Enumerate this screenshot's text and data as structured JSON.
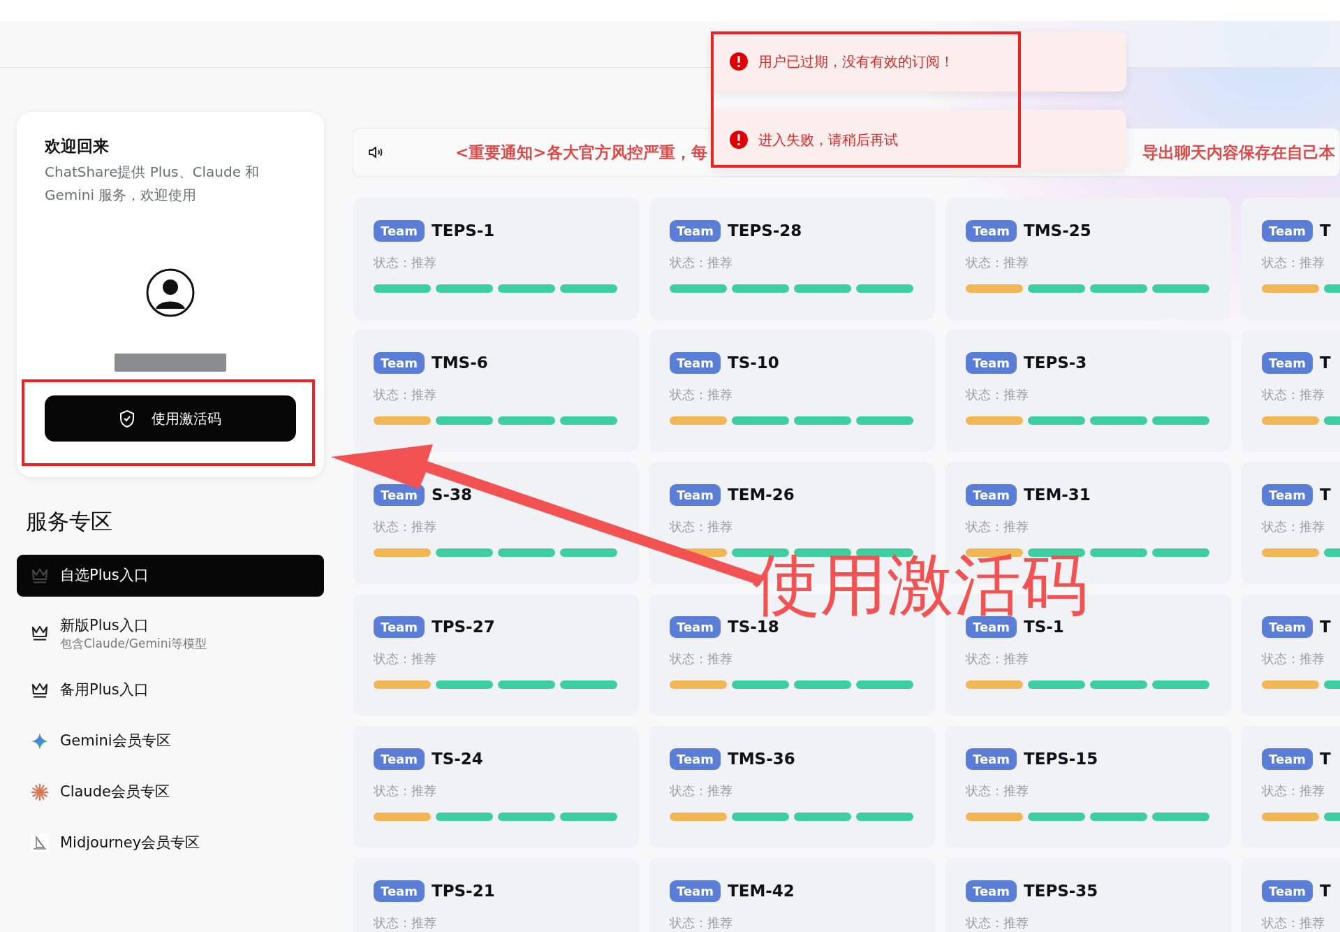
{
  "toasts": [
    {
      "message": "用户已过期，没有有效的订阅！"
    },
    {
      "message": "进入失败，请稍后再试"
    }
  ],
  "welcome": {
    "title": "欢迎回来",
    "subtitle": "ChatShare提供 Plus、Claude 和 Gemini 服务，欢迎使用",
    "activate_button": "使用激活码"
  },
  "services": {
    "heading": "服务专区",
    "items": [
      {
        "kind": "crown",
        "label": "自选Plus入口",
        "selected": true
      },
      {
        "kind": "crown",
        "label": "新版Plus入口",
        "sublabel": "包含Claude/Gemini等模型",
        "selected": false
      },
      {
        "kind": "crown",
        "label": "备用Plus入口",
        "selected": false
      },
      {
        "kind": "gemini",
        "label": "Gemini会员专区",
        "selected": false
      },
      {
        "kind": "claude",
        "label": "Claude会员专区",
        "selected": false
      },
      {
        "kind": "sailboat",
        "label": "Midjourney会员专区",
        "selected": false
      }
    ]
  },
  "notice": {
    "text_left": "<重要通知>各大官方风控严重，每",
    "text_right": "导出聊天内容保存在自己本"
  },
  "cards": [
    {
      "badge": "Team",
      "name": "TEPS-1",
      "status": "状态：推荐",
      "segments": [
        {
          "color": "#3ecfa0"
        },
        {
          "color": "#3ecfa0"
        },
        {
          "color": "#3ecfa0"
        },
        {
          "color": "#3ecfa0"
        }
      ]
    },
    {
      "badge": "Team",
      "name": "TEPS-28",
      "status": "状态：推荐",
      "segments": [
        {
          "color": "#3ecfa0"
        },
        {
          "color": "#3ecfa0"
        },
        {
          "color": "#3ecfa0"
        },
        {
          "color": "#3ecfa0"
        }
      ]
    },
    {
      "badge": "Team",
      "name": "TMS-25",
      "status": "状态：推荐",
      "segments": [
        {
          "color": "#f2b655"
        },
        {
          "color": "#3ecfa0"
        },
        {
          "color": "#3ecfa0"
        },
        {
          "color": "#3ecfa0"
        }
      ]
    },
    {
      "badge": "Team",
      "name": "T",
      "status": "状态：推荐",
      "segments": [
        {
          "color": "#f2b655"
        },
        {
          "color": "#3ecfa0"
        }
      ]
    },
    {
      "badge": "Team",
      "name": "TMS-6",
      "status": "状态：推荐",
      "segments": [
        {
          "color": "#f2b655"
        },
        {
          "color": "#3ecfa0"
        },
        {
          "color": "#3ecfa0"
        },
        {
          "color": "#3ecfa0"
        }
      ]
    },
    {
      "badge": "Team",
      "name": "TS-10",
      "status": "状态：推荐",
      "segments": [
        {
          "color": "#f2b655"
        },
        {
          "color": "#3ecfa0"
        },
        {
          "color": "#3ecfa0"
        },
        {
          "color": "#3ecfa0"
        }
      ]
    },
    {
      "badge": "Team",
      "name": "TEPS-3",
      "status": "状态：推荐",
      "segments": [
        {
          "color": "#f2b655"
        },
        {
          "color": "#3ecfa0"
        },
        {
          "color": "#3ecfa0"
        },
        {
          "color": "#3ecfa0"
        }
      ]
    },
    {
      "badge": "Team",
      "name": "T",
      "status": "状态：推荐",
      "segments": [
        {
          "color": "#f2b655"
        },
        {
          "color": "#3ecfa0"
        }
      ]
    },
    {
      "badge": "Team",
      "name": "S-38",
      "status": "状态：推荐",
      "segments": [
        {
          "color": "#f2b655"
        },
        {
          "color": "#3ecfa0"
        },
        {
          "color": "#3ecfa0"
        },
        {
          "color": "#3ecfa0"
        }
      ]
    },
    {
      "badge": "Team",
      "name": "TEM-26",
      "status": "状态：推荐",
      "segments": [
        {
          "color": "#f2b655"
        },
        {
          "color": "#3ecfa0"
        },
        {
          "color": "#3ecfa0"
        },
        {
          "color": "#3ecfa0"
        }
      ]
    },
    {
      "badge": "Team",
      "name": "TEM-31",
      "status": "状态：推荐",
      "segments": [
        {
          "color": "#f2b655"
        },
        {
          "color": "#3ecfa0"
        },
        {
          "color": "#3ecfa0"
        },
        {
          "color": "#3ecfa0"
        }
      ]
    },
    {
      "badge": "Team",
      "name": "T",
      "status": "状态：推荐",
      "segments": [
        {
          "color": "#f2b655"
        },
        {
          "color": "#3ecfa0"
        }
      ]
    },
    {
      "badge": "Team",
      "name": "TPS-27",
      "status": "状态：推荐",
      "segments": [
        {
          "color": "#f2b655"
        },
        {
          "color": "#3ecfa0"
        },
        {
          "color": "#3ecfa0"
        },
        {
          "color": "#3ecfa0"
        }
      ]
    },
    {
      "badge": "Team",
      "name": "TS-18",
      "status": "状态：推荐",
      "segments": [
        {
          "color": "#f2b655"
        },
        {
          "color": "#3ecfa0"
        },
        {
          "color": "#3ecfa0"
        },
        {
          "color": "#3ecfa0"
        }
      ]
    },
    {
      "badge": "Team",
      "name": "TS-1",
      "status": "状态：推荐",
      "segments": [
        {
          "color": "#f2b655"
        },
        {
          "color": "#3ecfa0"
        },
        {
          "color": "#3ecfa0"
        },
        {
          "color": "#3ecfa0"
        }
      ]
    },
    {
      "badge": "Team",
      "name": "T",
      "status": "状态：推荐",
      "segments": [
        {
          "color": "#f2b655"
        },
        {
          "color": "#3ecfa0"
        }
      ]
    },
    {
      "badge": "Team",
      "name": "TS-24",
      "status": "状态：推荐",
      "segments": [
        {
          "color": "#f2b655"
        },
        {
          "color": "#3ecfa0"
        },
        {
          "color": "#3ecfa0"
        },
        {
          "color": "#3ecfa0"
        }
      ]
    },
    {
      "badge": "Team",
      "name": "TMS-36",
      "status": "状态：推荐",
      "segments": [
        {
          "color": "#f2b655"
        },
        {
          "color": "#3ecfa0"
        },
        {
          "color": "#3ecfa0"
        },
        {
          "color": "#3ecfa0"
        }
      ]
    },
    {
      "badge": "Team",
      "name": "TEPS-15",
      "status": "状态：推荐",
      "segments": [
        {
          "color": "#f2b655"
        },
        {
          "color": "#3ecfa0"
        },
        {
          "color": "#3ecfa0"
        },
        {
          "color": "#3ecfa0"
        }
      ]
    },
    {
      "badge": "Team",
      "name": "T",
      "status": "状态：推荐",
      "segments": [
        {
          "color": "#f2b655"
        },
        {
          "color": "#3ecfa0"
        }
      ]
    },
    {
      "badge": "Team",
      "name": "TPS-21",
      "status": "状态：推荐"
    },
    {
      "badge": "Team",
      "name": "TEM-42",
      "status": "状态：推荐"
    },
    {
      "badge": "Team",
      "name": "TEPS-35",
      "status": "状态：推荐"
    },
    {
      "badge": "Team",
      "name": "T",
      "status": "状态：推荐"
    }
  ],
  "annotation": {
    "label": "使用激活码"
  }
}
